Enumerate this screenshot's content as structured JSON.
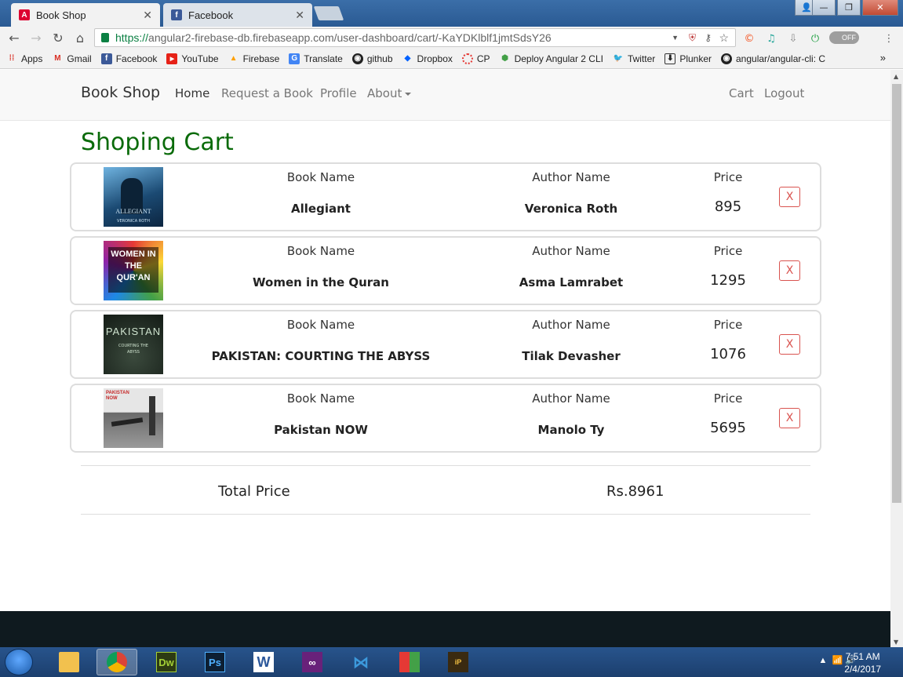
{
  "browser": {
    "tabs": [
      {
        "title": "Book Shop",
        "active": true,
        "icon": "angular-icon"
      },
      {
        "title": "Facebook",
        "active": false,
        "icon": "facebook-icon"
      }
    ],
    "url_scheme": "https://",
    "url_rest": "angular2-firebase-db.firebaseapp.com/user-dashboard/cart/-KaYDKlblf1jmtSdsY26",
    "extension_toggle": "OFF",
    "bookmarks": [
      "Apps",
      "Gmail",
      "Facebook",
      "YouTube",
      "Firebase",
      "Translate",
      "github",
      "Dropbox",
      "CP",
      "Deploy Angular 2 CLI",
      "Twitter",
      "Plunker",
      "angular/angular-cli: C"
    ],
    "bookmarks_more": "»"
  },
  "navbar": {
    "brand": "Book Shop",
    "links": [
      "Home",
      "Request a Book",
      "Profile",
      "About"
    ],
    "right_links": [
      "Cart",
      "Logout"
    ]
  },
  "page": {
    "heading": "Shoping Cart",
    "headers": {
      "book": "Book Name",
      "author": "Author Name",
      "price": "Price"
    },
    "remove_label": "X",
    "items": [
      {
        "book": "Allegiant",
        "author": "Veronica Roth",
        "price": "895",
        "cover_text": "ALLEGIANT",
        "cover_sub": "VERONICA ROTH",
        "cover_color": "#1b4a73"
      },
      {
        "book": "Women in the Quran",
        "author": "Asma Lamrabet",
        "price": "1295",
        "cover_text": "WOMEN IN THE QUR'AN",
        "cover_sub": "",
        "cover_color": "#c2185b"
      },
      {
        "book": "PAKISTAN: COURTING THE ABYSS",
        "author": "Tilak Devasher",
        "price": "1076",
        "cover_text": "PAKISTAN",
        "cover_sub": "COURTING THE ABYSS",
        "cover_color": "#1f2b22"
      },
      {
        "book": "Pakistan NOW",
        "author": "Manolo Ty",
        "price": "5695",
        "cover_text": "PAKISTAN NOW",
        "cover_sub": "",
        "cover_color": "#8a8a8a"
      }
    ],
    "total_label": "Total Price",
    "total_value": "Rs.8961"
  },
  "taskbar": {
    "time": "7:51 AM",
    "date": "2/4/2017"
  }
}
